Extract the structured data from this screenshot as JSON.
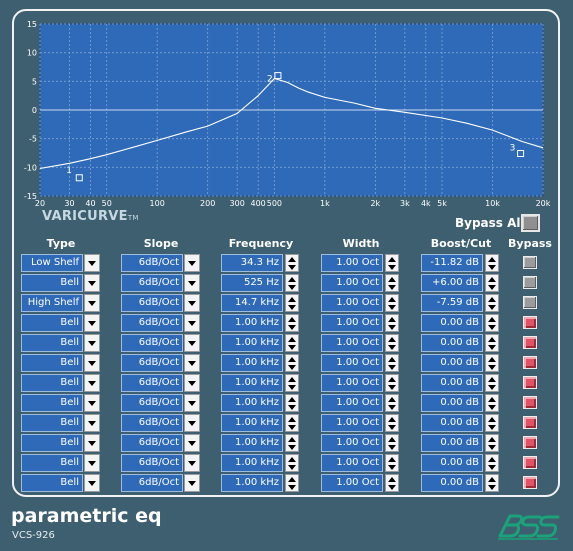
{
  "graph": {
    "x_ticks": [
      "20",
      "30",
      "40",
      "50",
      "100",
      "200",
      "300",
      "400",
      "500",
      "1k",
      "2k",
      "3k",
      "4k",
      "5k",
      "10k",
      "20k"
    ],
    "y_ticks": [
      "15",
      "10",
      "5",
      "0",
      "-5",
      "-10",
      "-15"
    ],
    "node_labels": [
      "1",
      "2",
      "3"
    ]
  },
  "chart_data": {
    "type": "line",
    "xscale": "log",
    "xlim": [
      20,
      20000
    ],
    "ylim": [
      -15,
      15
    ],
    "grid": true,
    "x_tick_values": [
      20,
      30,
      40,
      50,
      100,
      200,
      300,
      400,
      500,
      1000,
      2000,
      3000,
      4000,
      5000,
      10000,
      20000
    ],
    "y_tick_values": [
      15,
      10,
      5,
      0,
      -5,
      -10,
      -15
    ],
    "curve": {
      "x": [
        20,
        30,
        40,
        50,
        70,
        100,
        150,
        200,
        300,
        400,
        500,
        600,
        700,
        800,
        1000,
        1500,
        2000,
        3000,
        5000,
        7000,
        10000,
        15000,
        20000
      ],
      "y": [
        -10.2,
        -9.3,
        -8.5,
        -7.8,
        -6.6,
        -5.3,
        -3.8,
        -2.8,
        -0.6,
        2.5,
        5.5,
        4.8,
        3.8,
        3.1,
        2.2,
        1.2,
        0.3,
        -0.4,
        -1.4,
        -2.3,
        -3.5,
        -5.5,
        -6.6
      ]
    },
    "nodes": [
      {
        "label": "1",
        "freq": 34.3,
        "gain": -11.82
      },
      {
        "label": "2",
        "freq": 525,
        "gain": 6.0
      },
      {
        "label": "3",
        "freq": 14700,
        "gain": -7.59
      }
    ]
  },
  "brand": {
    "varicurve": "VARICURVE",
    "tm": "TM"
  },
  "bypass_all": {
    "label": "Bypass All"
  },
  "headers": {
    "type": "Type",
    "slope": "Slope",
    "frequency": "Frequency",
    "width": "Width",
    "boost_cut": "Boost/Cut",
    "bypass": "Bypass"
  },
  "bands": [
    {
      "type": "Low Shelf",
      "slope": "6dB/Oct",
      "freq": "34.3 Hz",
      "width": "1.00 Oct",
      "gain": "-11.82 dB",
      "bypassed": false
    },
    {
      "type": "Bell",
      "slope": "6dB/Oct",
      "freq": "525 Hz",
      "width": "1.00 Oct",
      "gain": "+6.00 dB",
      "bypassed": false
    },
    {
      "type": "High Shelf",
      "slope": "6dB/Oct",
      "freq": "14.7 kHz",
      "width": "1.00 Oct",
      "gain": "-7.59 dB",
      "bypassed": false
    },
    {
      "type": "Bell",
      "slope": "6dB/Oct",
      "freq": "1.00 kHz",
      "width": "1.00 Oct",
      "gain": "0.00 dB",
      "bypassed": true
    },
    {
      "type": "Bell",
      "slope": "6dB/Oct",
      "freq": "1.00 kHz",
      "width": "1.00 Oct",
      "gain": "0.00 dB",
      "bypassed": true
    },
    {
      "type": "Bell",
      "slope": "6dB/Oct",
      "freq": "1.00 kHz",
      "width": "1.00 Oct",
      "gain": "0.00 dB",
      "bypassed": true
    },
    {
      "type": "Bell",
      "slope": "6dB/Oct",
      "freq": "1.00 kHz",
      "width": "1.00 Oct",
      "gain": "0.00 dB",
      "bypassed": true
    },
    {
      "type": "Bell",
      "slope": "6dB/Oct",
      "freq": "1.00 kHz",
      "width": "1.00 Oct",
      "gain": "0.00 dB",
      "bypassed": true
    },
    {
      "type": "Bell",
      "slope": "6dB/Oct",
      "freq": "1.00 kHz",
      "width": "1.00 Oct",
      "gain": "0.00 dB",
      "bypassed": true
    },
    {
      "type": "Bell",
      "slope": "6dB/Oct",
      "freq": "1.00 kHz",
      "width": "1.00 Oct",
      "gain": "0.00 dB",
      "bypassed": true
    },
    {
      "type": "Bell",
      "slope": "6dB/Oct",
      "freq": "1.00 kHz",
      "width": "1.00 Oct",
      "gain": "0.00 dB",
      "bypassed": true
    },
    {
      "type": "Bell",
      "slope": "6dB/Oct",
      "freq": "1.00 kHz",
      "width": "1.00 Oct",
      "gain": "0.00 dB",
      "bypassed": true
    }
  ],
  "footer": {
    "title": "parametric eq",
    "model": "VCS-926"
  },
  "colors": {
    "background": "#3d5f6f",
    "graph_bg": "#2f6ab8",
    "cell_bg": "#2f6ab8",
    "bypass_on": "#e05468",
    "bypass_off": "#9c9c9c",
    "logo": "#1aa37a"
  },
  "icons": {
    "logo": "bss-logo-icon"
  }
}
